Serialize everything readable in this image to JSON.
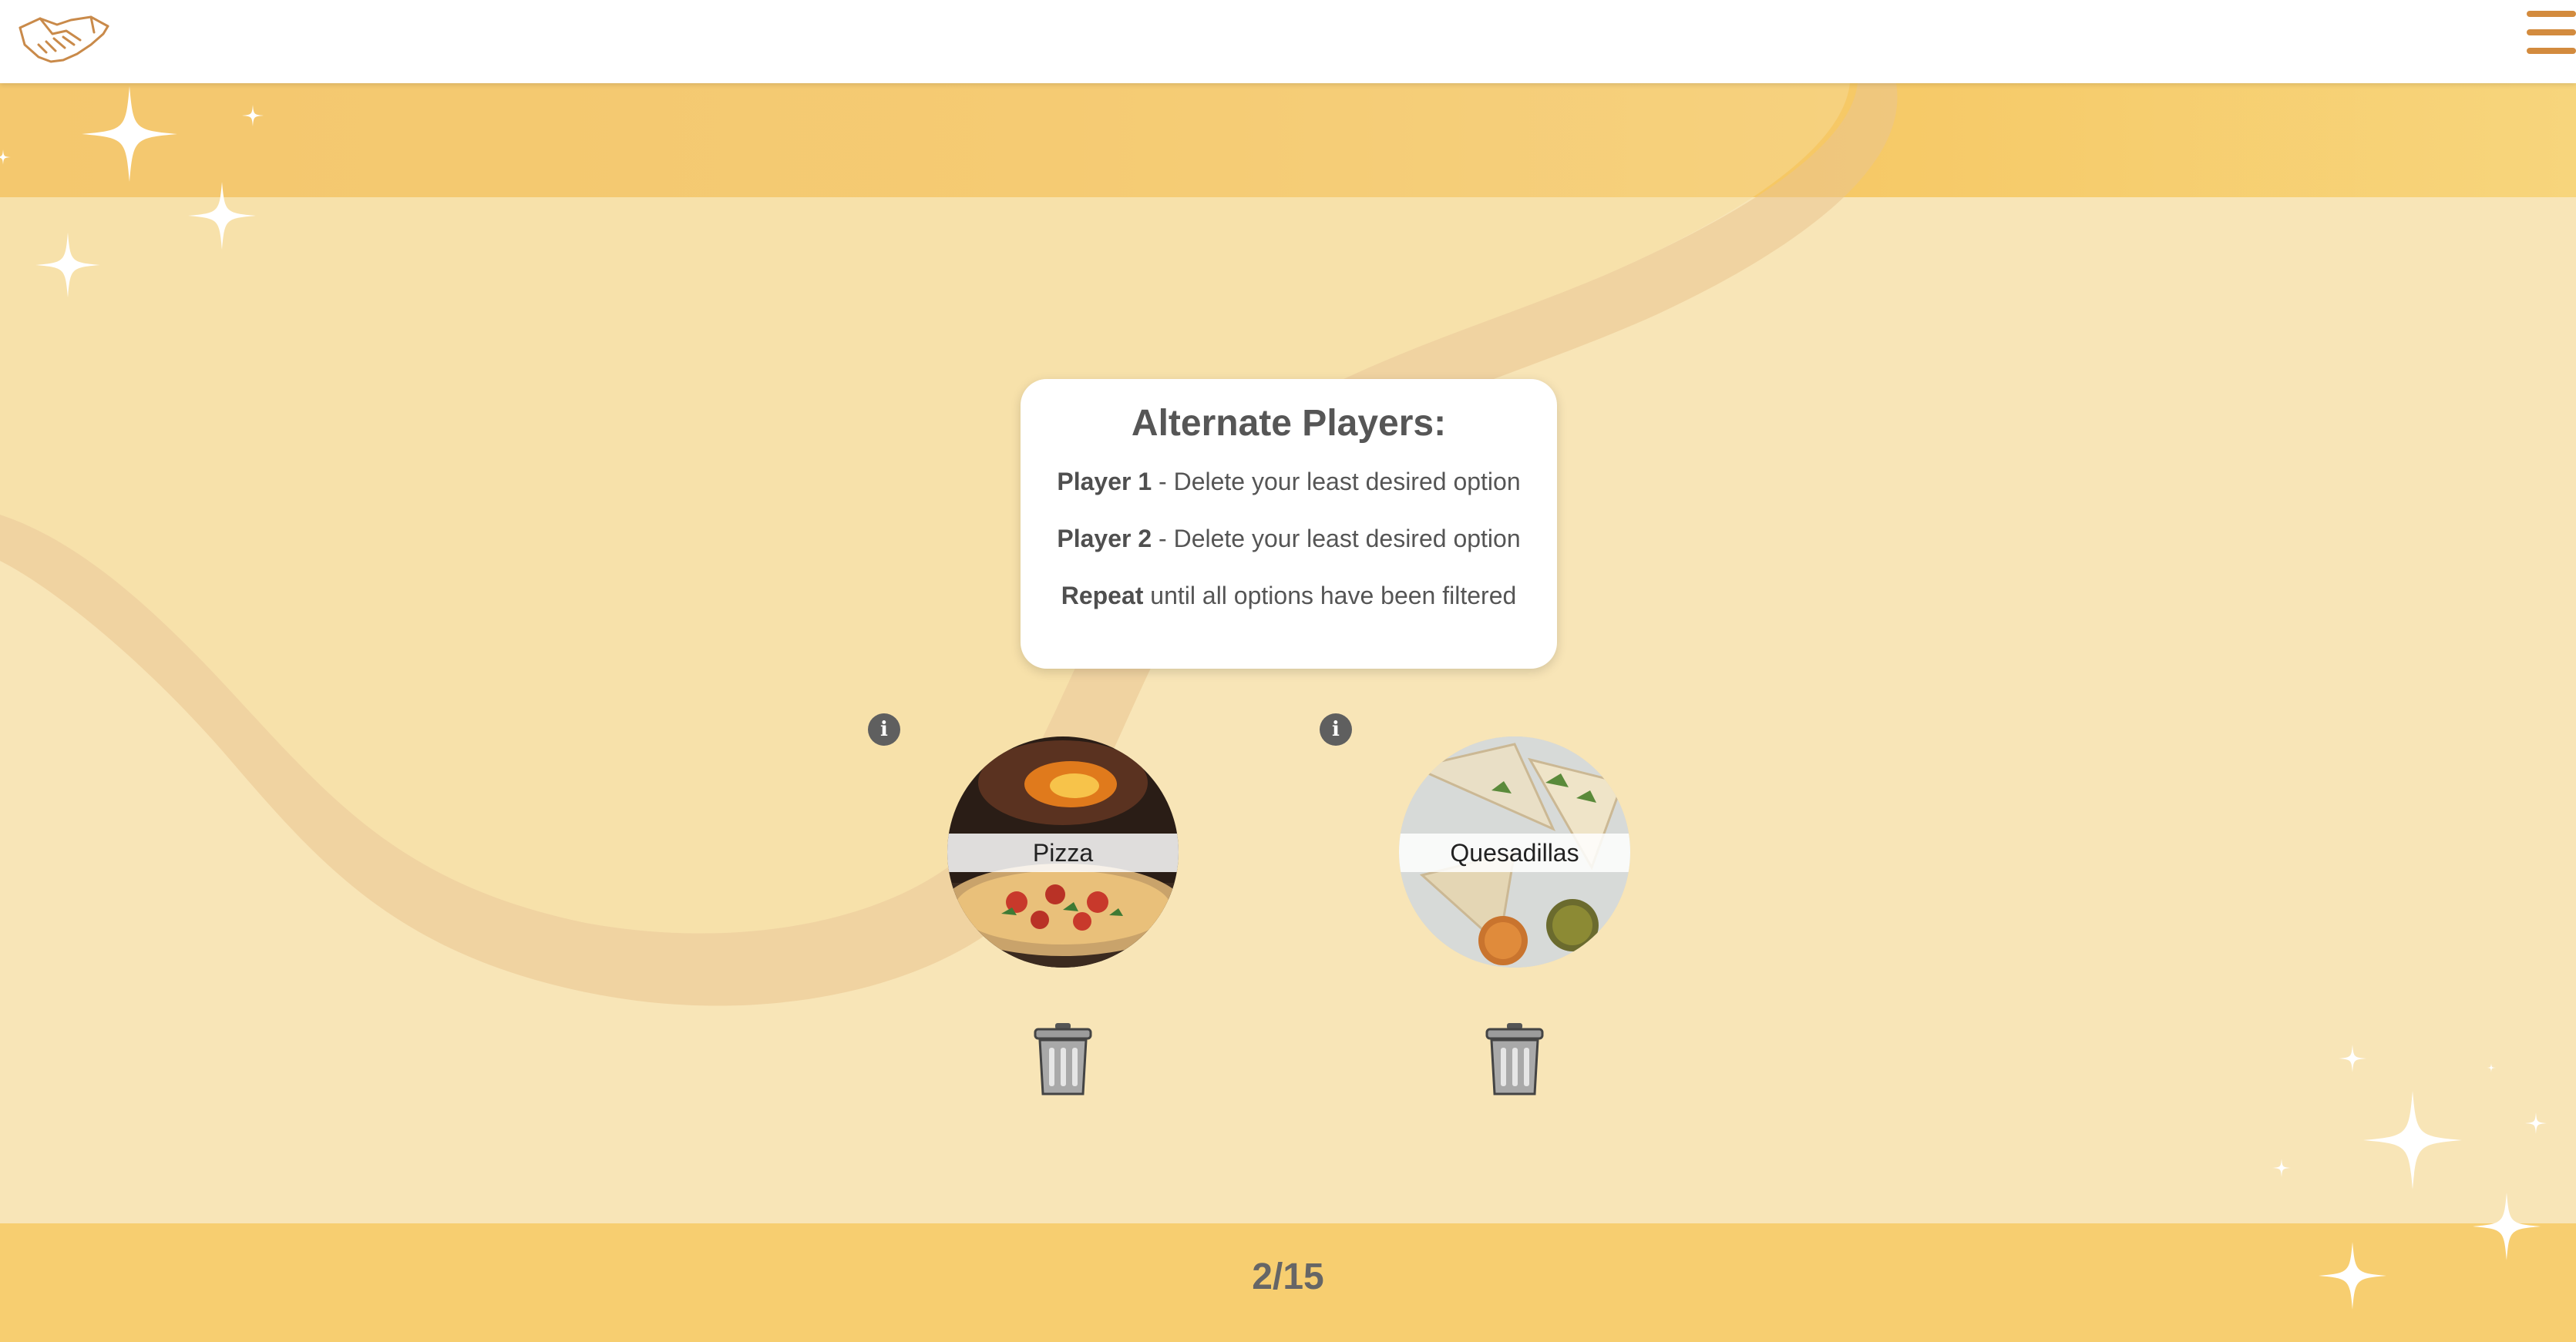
{
  "header": {
    "logo_icon": "handshake-icon",
    "menu_icon": "hamburger-menu-icon",
    "accent_color": "#d38b3e"
  },
  "instructions": {
    "title": "Alternate Players:",
    "lines": [
      {
        "bold": "Player 1",
        "text": " - Delete your least desired option"
      },
      {
        "bold": "Player 2",
        "text": " - Delete your least desired option"
      },
      {
        "bold": "Repeat",
        "text": " until all options have been filtered"
      }
    ]
  },
  "options": [
    {
      "label": "Pizza",
      "info_icon": "info-icon",
      "delete_icon": "trash-can-icon"
    },
    {
      "label": "Quesadillas",
      "info_icon": "info-icon",
      "delete_icon": "trash-can-icon"
    }
  ],
  "progress": {
    "text": "2/15",
    "current": 2,
    "total": 15
  },
  "colors": {
    "band": "#f7ce70",
    "background": "#f8e5b7",
    "card": "#ffffff",
    "text": "#555555"
  }
}
